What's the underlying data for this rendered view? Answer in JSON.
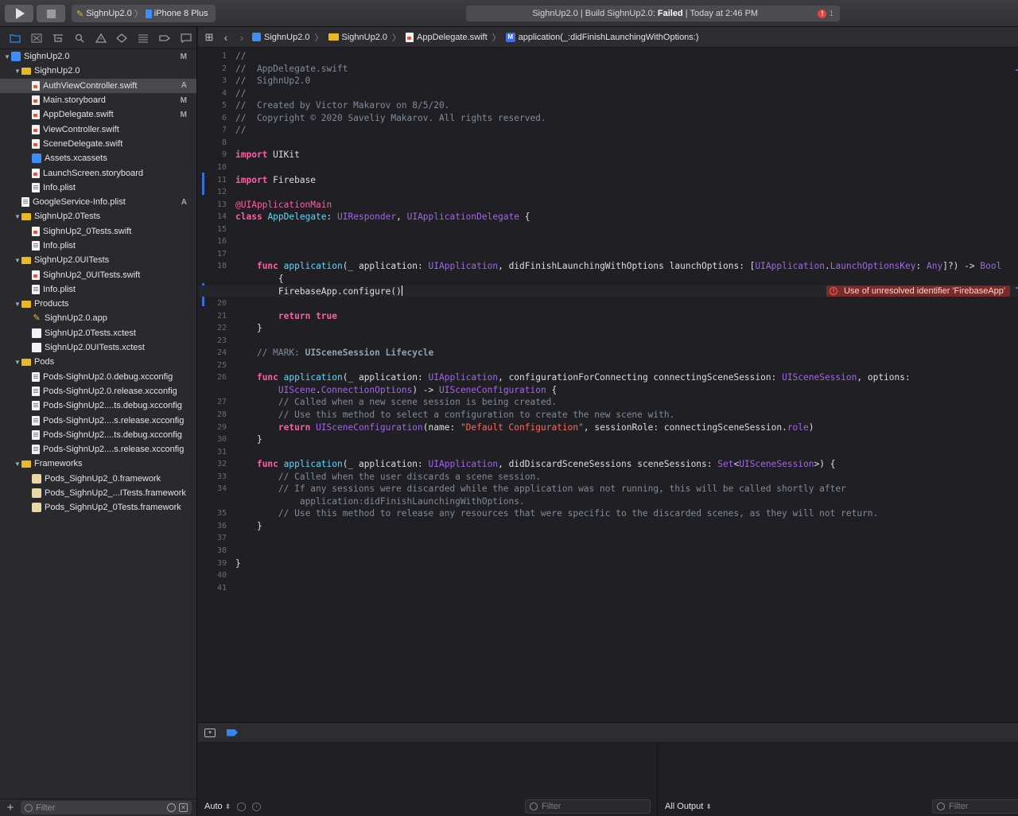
{
  "toolbar": {
    "scheme_name": "SighnUp2.0",
    "scheme_sep": "〉",
    "device": "iPhone 8 Plus",
    "activity_prefix": "SighnUp2.0 | Build SighnUp2.0: ",
    "activity_status": "Failed",
    "activity_suffix": " | Today at 2:46 PM",
    "error_count": "1",
    "error_glyph": "!"
  },
  "navigator": {
    "items": [
      {
        "label": "SighnUp2.0",
        "badge": "M",
        "icon": "project-icon",
        "indent": 0,
        "tri": "▼"
      },
      {
        "label": "SighnUp2.0",
        "badge": "",
        "icon": "folder-icon",
        "indent": 1,
        "tri": "▼"
      },
      {
        "label": "AuthViewController.swift",
        "badge": "A",
        "icon": "swift-file-icon",
        "indent": 2,
        "tri": "",
        "selected": true
      },
      {
        "label": "Main.storyboard",
        "badge": "M",
        "icon": "storyboard-icon",
        "indent": 2,
        "tri": ""
      },
      {
        "label": "AppDelegate.swift",
        "badge": "M",
        "icon": "swift-file-icon",
        "indent": 2,
        "tri": ""
      },
      {
        "label": "ViewController.swift",
        "badge": "",
        "icon": "swift-file-icon",
        "indent": 2,
        "tri": ""
      },
      {
        "label": "SceneDelegate.swift",
        "badge": "",
        "icon": "swift-file-icon",
        "indent": 2,
        "tri": ""
      },
      {
        "label": "Assets.xcassets",
        "badge": "",
        "icon": "assets-icon",
        "indent": 2,
        "tri": ""
      },
      {
        "label": "LaunchScreen.storyboard",
        "badge": "",
        "icon": "storyboard-icon",
        "indent": 2,
        "tri": ""
      },
      {
        "label": "Info.plist",
        "badge": "",
        "icon": "plist-icon",
        "indent": 2,
        "tri": ""
      },
      {
        "label": "GoogleService-Info.plist",
        "badge": "A",
        "icon": "plist-icon",
        "indent": 1,
        "tri": ""
      },
      {
        "label": "SighnUp2.0Tests",
        "badge": "",
        "icon": "folder-icon",
        "indent": 1,
        "tri": "▼"
      },
      {
        "label": "SighnUp2_0Tests.swift",
        "badge": "",
        "icon": "swift-file-icon",
        "indent": 2,
        "tri": ""
      },
      {
        "label": "Info.plist",
        "badge": "",
        "icon": "plist-icon",
        "indent": 2,
        "tri": ""
      },
      {
        "label": "SighnUp2.0UITests",
        "badge": "",
        "icon": "folder-icon",
        "indent": 1,
        "tri": "▼"
      },
      {
        "label": "SighnUp2_0UITests.swift",
        "badge": "",
        "icon": "swift-file-icon",
        "indent": 2,
        "tri": ""
      },
      {
        "label": "Info.plist",
        "badge": "",
        "icon": "plist-icon",
        "indent": 2,
        "tri": ""
      },
      {
        "label": "Products",
        "badge": "",
        "icon": "folder-icon",
        "indent": 1,
        "tri": "▼"
      },
      {
        "label": "SighnUp2.0.app",
        "badge": "",
        "icon": "app-icon",
        "indent": 2,
        "tri": ""
      },
      {
        "label": "SighnUp2.0Tests.xctest",
        "badge": "",
        "icon": "xctest-icon",
        "indent": 2,
        "tri": ""
      },
      {
        "label": "SighnUp2.0UITests.xctest",
        "badge": "",
        "icon": "xctest-icon",
        "indent": 2,
        "tri": ""
      },
      {
        "label": "Pods",
        "badge": "",
        "icon": "folder-icon",
        "indent": 1,
        "tri": "▼"
      },
      {
        "label": "Pods-SighnUp2.0.debug.xcconfig",
        "badge": "",
        "icon": "config-file-icon",
        "indent": 2,
        "tri": ""
      },
      {
        "label": "Pods-SighnUp2.0.release.xcconfig",
        "badge": "",
        "icon": "config-file-icon",
        "indent": 2,
        "tri": ""
      },
      {
        "label": "Pods-SighnUp2....ts.debug.xcconfig",
        "badge": "",
        "icon": "config-file-icon",
        "indent": 2,
        "tri": ""
      },
      {
        "label": "Pods-SighnUp2....s.release.xcconfig",
        "badge": "",
        "icon": "config-file-icon",
        "indent": 2,
        "tri": ""
      },
      {
        "label": "Pods-SighnUp2....ts.debug.xcconfig",
        "badge": "",
        "icon": "config-file-icon",
        "indent": 2,
        "tri": ""
      },
      {
        "label": "Pods-SighnUp2....s.release.xcconfig",
        "badge": "",
        "icon": "config-file-icon",
        "indent": 2,
        "tri": ""
      },
      {
        "label": "Frameworks",
        "badge": "",
        "icon": "folder-icon",
        "indent": 1,
        "tri": "▼"
      },
      {
        "label": "Pods_SighnUp2_0.framework",
        "badge": "",
        "icon": "framework-icon",
        "indent": 2,
        "tri": ""
      },
      {
        "label": "Pods_SighnUp2_...ITests.framework",
        "badge": "",
        "icon": "framework-icon",
        "indent": 2,
        "tri": ""
      },
      {
        "label": "Pods_SighnUp2_0Tests.framework",
        "badge": "",
        "icon": "framework-icon",
        "indent": 2,
        "tri": ""
      }
    ],
    "filter_placeholder": "Filter",
    "add_glyph": "+"
  },
  "jumpbar": {
    "crumbs": [
      "SighnUp2.0",
      "SighnUp2.0",
      "AppDelegate.swift",
      "application(_:didFinishLaunchingWithOptions:)"
    ],
    "sep": "〉",
    "method_badge": "M"
  },
  "editor": {
    "current_line": 19,
    "error_message": "Use of unresolved identifier 'FirebaseApp'",
    "error_glyph": "!",
    "lines": [
      {
        "n": "1",
        "segs": [
          [
            "c-com",
            "//"
          ]
        ]
      },
      {
        "n": "2",
        "segs": [
          [
            "c-com",
            "//  AppDelegate.swift"
          ]
        ]
      },
      {
        "n": "3",
        "segs": [
          [
            "c-com",
            "//  SighnUp2.0"
          ]
        ]
      },
      {
        "n": "4",
        "segs": [
          [
            "c-com",
            "//"
          ]
        ]
      },
      {
        "n": "5",
        "segs": [
          [
            "c-com",
            "//  Created by Victor Makarov on 8/5/20."
          ]
        ]
      },
      {
        "n": "6",
        "segs": [
          [
            "c-com",
            "//  Copyright © 2020 Saveliy Makarov. All rights reserved."
          ]
        ]
      },
      {
        "n": "7",
        "segs": [
          [
            "c-com",
            "//"
          ]
        ]
      },
      {
        "n": "8",
        "segs": []
      },
      {
        "n": "9",
        "segs": [
          [
            "c-kw",
            "import"
          ],
          [
            "c-plain",
            " UIKit"
          ]
        ]
      },
      {
        "n": "10",
        "segs": []
      },
      {
        "n": "11",
        "segs": [
          [
            "c-kw",
            "import"
          ],
          [
            "c-plain",
            " Firebase"
          ]
        ]
      },
      {
        "n": "12",
        "segs": []
      },
      {
        "n": "13",
        "segs": [
          [
            "c-attr",
            "@UIApplicationMain"
          ]
        ]
      },
      {
        "n": "14",
        "segs": [
          [
            "c-kw",
            "class"
          ],
          [
            "c-plain",
            " "
          ],
          [
            "c-cls",
            "AppDelegate"
          ],
          [
            "c-plain",
            ": "
          ],
          [
            "c-type",
            "UIResponder"
          ],
          [
            "c-plain",
            ", "
          ],
          [
            "c-type",
            "UIApplicationDelegate"
          ],
          [
            "c-plain",
            " {"
          ]
        ]
      },
      {
        "n": "15",
        "segs": []
      },
      {
        "n": "16",
        "segs": []
      },
      {
        "n": "17",
        "segs": []
      },
      {
        "n": "18",
        "segs": [
          [
            "c-plain",
            "    "
          ],
          [
            "c-kw",
            "func"
          ],
          [
            "c-plain",
            " "
          ],
          [
            "c-cls",
            "application"
          ],
          [
            "c-plain",
            "(_ application: "
          ],
          [
            "c-type",
            "UIApplication"
          ],
          [
            "c-plain",
            ", didFinishLaunchingWithOptions launchOptions: ["
          ],
          [
            "c-type",
            "UIApplication"
          ],
          [
            "c-plain",
            "."
          ],
          [
            "c-type",
            "LaunchOptionsKey"
          ],
          [
            "c-plain",
            ": "
          ],
          [
            "c-type",
            "Any"
          ],
          [
            "c-plain",
            "]?) -> "
          ],
          [
            "c-type",
            "Bool"
          ]
        ]
      },
      {
        "n": "",
        "segs": [
          [
            "c-plain",
            "        {"
          ]
        ]
      },
      {
        "n": "19",
        "segs": [
          [
            "c-plain",
            "        FirebaseApp.configure()"
          ]
        ],
        "caret": true
      },
      {
        "n": "20",
        "segs": []
      },
      {
        "n": "21",
        "segs": [
          [
            "c-plain",
            "        "
          ],
          [
            "c-kw",
            "return"
          ],
          [
            "c-plain",
            " "
          ],
          [
            "c-kw",
            "true"
          ]
        ]
      },
      {
        "n": "22",
        "segs": [
          [
            "c-plain",
            "    }"
          ]
        ]
      },
      {
        "n": "23",
        "segs": []
      },
      {
        "n": "24",
        "segs": [
          [
            "c-plain",
            "    "
          ],
          [
            "c-com",
            "// MARK: "
          ],
          [
            "c-mark",
            "UISceneSession Lifecycle"
          ]
        ]
      },
      {
        "n": "25",
        "segs": []
      },
      {
        "n": "26",
        "segs": [
          [
            "c-plain",
            "    "
          ],
          [
            "c-kw",
            "func"
          ],
          [
            "c-plain",
            " "
          ],
          [
            "c-cls",
            "application"
          ],
          [
            "c-plain",
            "(_ application: "
          ],
          [
            "c-type",
            "UIApplication"
          ],
          [
            "c-plain",
            ", configurationForConnecting connectingSceneSession: "
          ],
          [
            "c-type",
            "UISceneSession"
          ],
          [
            "c-plain",
            ", options:"
          ]
        ]
      },
      {
        "n": "",
        "segs": [
          [
            "c-plain",
            "        "
          ],
          [
            "c-type",
            "UIScene"
          ],
          [
            "c-plain",
            "."
          ],
          [
            "c-type",
            "ConnectionOptions"
          ],
          [
            "c-plain",
            ") -> "
          ],
          [
            "c-type",
            "UISceneConfiguration"
          ],
          [
            "c-plain",
            " {"
          ]
        ]
      },
      {
        "n": "27",
        "segs": [
          [
            "c-plain",
            "        "
          ],
          [
            "c-com",
            "// Called when a new scene session is being created."
          ]
        ]
      },
      {
        "n": "28",
        "segs": [
          [
            "c-plain",
            "        "
          ],
          [
            "c-com",
            "// Use this method to select a configuration to create the new scene with."
          ]
        ]
      },
      {
        "n": "29",
        "segs": [
          [
            "c-plain",
            "        "
          ],
          [
            "c-kw",
            "return"
          ],
          [
            "c-plain",
            " "
          ],
          [
            "c-type",
            "UISceneConfiguration"
          ],
          [
            "c-plain",
            "(name: "
          ],
          [
            "c-str",
            "\"Default Configuration\""
          ],
          [
            "c-plain",
            ", sessionRole: connectingSceneSession."
          ],
          [
            "c-fn",
            "role"
          ],
          [
            "c-plain",
            ")"
          ]
        ]
      },
      {
        "n": "30",
        "segs": [
          [
            "c-plain",
            "    }"
          ]
        ]
      },
      {
        "n": "31",
        "segs": []
      },
      {
        "n": "32",
        "segs": [
          [
            "c-plain",
            "    "
          ],
          [
            "c-kw",
            "func"
          ],
          [
            "c-plain",
            " "
          ],
          [
            "c-cls",
            "application"
          ],
          [
            "c-plain",
            "(_ application: "
          ],
          [
            "c-type",
            "UIApplication"
          ],
          [
            "c-plain",
            ", didDiscardSceneSessions sceneSessions: "
          ],
          [
            "c-type",
            "Set"
          ],
          [
            "c-plain",
            "<"
          ],
          [
            "c-type",
            "UISceneSession"
          ],
          [
            "c-plain",
            ">) {"
          ]
        ]
      },
      {
        "n": "33",
        "segs": [
          [
            "c-plain",
            "        "
          ],
          [
            "c-com",
            "// Called when the user discards a scene session."
          ]
        ]
      },
      {
        "n": "34",
        "segs": [
          [
            "c-plain",
            "        "
          ],
          [
            "c-com",
            "// If any sessions were discarded while the application was not running, this will be called shortly after"
          ]
        ]
      },
      {
        "n": "",
        "segs": [
          [
            "c-plain",
            "            "
          ],
          [
            "c-com",
            "application:didFinishLaunchingWithOptions."
          ]
        ]
      },
      {
        "n": "35",
        "segs": [
          [
            "c-plain",
            "        "
          ],
          [
            "c-com",
            "// Use this method to release any resources that were specific to the discarded scenes, as they will not return."
          ]
        ]
      },
      {
        "n": "36",
        "segs": [
          [
            "c-plain",
            "    }"
          ]
        ]
      },
      {
        "n": "37",
        "segs": []
      },
      {
        "n": "38",
        "segs": []
      },
      {
        "n": "39",
        "segs": [
          [
            "c-plain",
            "}"
          ]
        ]
      },
      {
        "n": "40",
        "segs": []
      },
      {
        "n": "41",
        "segs": []
      }
    ]
  },
  "debug": {
    "variables_scope": "Auto",
    "variables_filter_placeholder": "Filter",
    "console_output": "All Output",
    "console_filter_placeholder": "Filter",
    "updown_glyph": "⬍",
    "toggle_glyph": "▾",
    "info_glyph": "i",
    "box_glyph": "✕"
  },
  "colors": {
    "accent": "#2f87f5",
    "error": "#e2453c",
    "keyword": "#fc5fa3",
    "type": "#a167e6",
    "declaration": "#5dd8ff",
    "comment": "#7f8c98",
    "string": "#fc6a5d"
  }
}
